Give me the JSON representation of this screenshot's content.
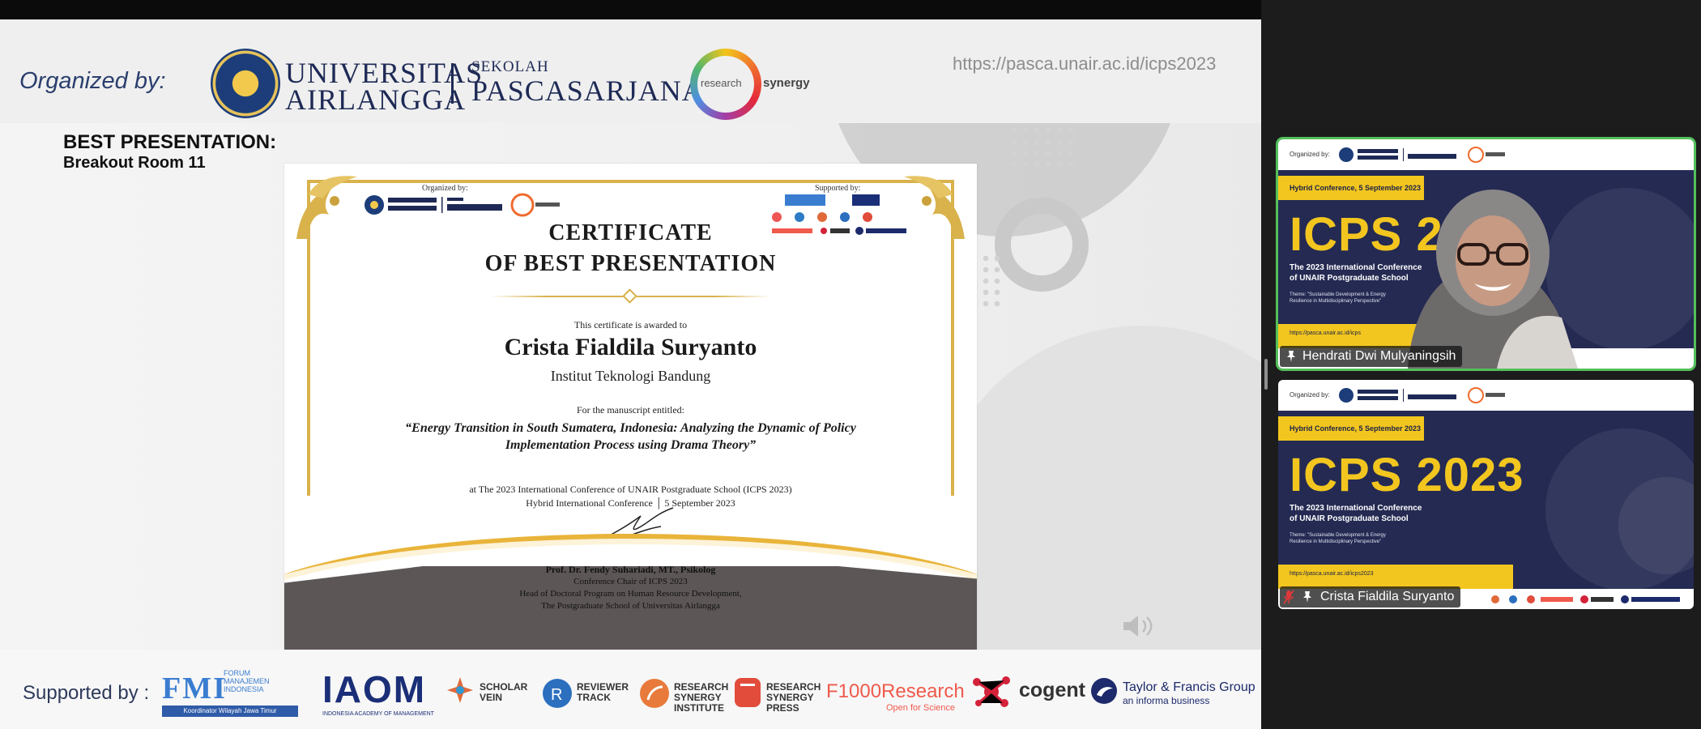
{
  "share": {
    "header": {
      "organized_label": "Organized by:",
      "unair_line1": "UNIVERSITAS",
      "unair_line2": "AIRLANGGA",
      "sekolah_line1": "SEKOLAH",
      "sekolah_line2": "PASCASARJANA",
      "rs_label": "research",
      "rs_word": "synergy",
      "url": "https://pasca.unair.ac.id/icps2023"
    },
    "award": {
      "title": "BEST PRESENTATION:",
      "room": "Breakout Room 11"
    },
    "certificate": {
      "organized_by": "Organized by:",
      "supported_by": "Supported by:",
      "title_line1": "CERTIFICATE",
      "title_line2": "OF BEST PRESENTATION",
      "awarded_to": "This certificate is awarded to",
      "recipient": "Crista Fialdila Suryanto",
      "institution": "Institut Teknologi Bandung",
      "manuscript_label": "For the manuscript entitled:",
      "manuscript_title": "“Energy Transition in South Sumatera, Indonesia: Analyzing the Dynamic of Policy Implementation Process using Drama Theory”",
      "event_line1": "at The 2023 International Conference of UNAIR Postgraduate School (ICPS 2023)",
      "event_line2": "Hybrid International Conference │ 5 September 2023",
      "signer": "Prof. Dr. Fendy Suhariadi, MT., Psikolog",
      "signer_role1": "Conference Chair of ICPS 2023",
      "signer_role2": "Head of Doctoral Program on Human Resource Development,",
      "signer_role3": "The Postgraduate School of Universitas Airlangga"
    },
    "footer": {
      "supported_label": "Supported by :",
      "fmi": "FMI",
      "fmi_sub": "FORUM MANAJEMEN INDONESIA",
      "fmi_bar": "Koordinator Wilayah Jawa Timur",
      "iaom": "IAOM",
      "iaom_sub": "INDONESIA ACADEMY OF MANAGEMENT",
      "scholar_vein": "SCHOLAR VEIN",
      "reviewer_track": "REVIEWER TRACK",
      "rsi": "RESEARCH SYNERGY INSTITUTE",
      "rsp": "RESEARCH SYNERGY PRESS",
      "f1000": "F1000Research",
      "f1000_sub": "Open for Science",
      "cogent": "cogent",
      "tf_line1": "Taylor & Francis Group",
      "tf_line2": "an informa business"
    }
  },
  "participants": [
    {
      "name": "Hendrati Dwi Mulyaningsih",
      "active_speaker": true,
      "muted": false,
      "pinned": true,
      "bg_date": "Hybrid Conference, 5 September 2023",
      "bg_big": "ICPS 20",
      "bg_sub1": "The 2023 International Conference",
      "bg_sub2": "of UNAIR Postgraduate School",
      "bg_theme": "Theme: \"Sustainable Development & Energy Resilience in Multidisciplinary Perspective\"",
      "bg_url": "https://pasca.unair.ac.id/icps",
      "bg_org": "Organized by:"
    },
    {
      "name": "Crista Fialdila Suryanto",
      "active_speaker": false,
      "muted": true,
      "pinned": true,
      "bg_date": "Hybrid Conference, 5 September 2023",
      "bg_big": "ICPS 2023",
      "bg_sub1": "The 2023 International Conference",
      "bg_sub2": "of UNAIR Postgraduate School",
      "bg_theme": "Theme: \"Sustainable Development & Energy Resilience in Multidisciplinary Perspective\"",
      "bg_url": "https://pasca.unair.ac.id/icps2023",
      "bg_org": "Organized by:"
    }
  ],
  "colors": {
    "accent_gold": "#d9b24c",
    "active_speaker_border": "#53c05a",
    "tile_bg": "#242a52",
    "tile_yellow": "#f2c61f"
  },
  "icons": {
    "pin": "pin-icon",
    "mic_muted": "mic-muted-icon",
    "speaker": "speaker-icon"
  }
}
